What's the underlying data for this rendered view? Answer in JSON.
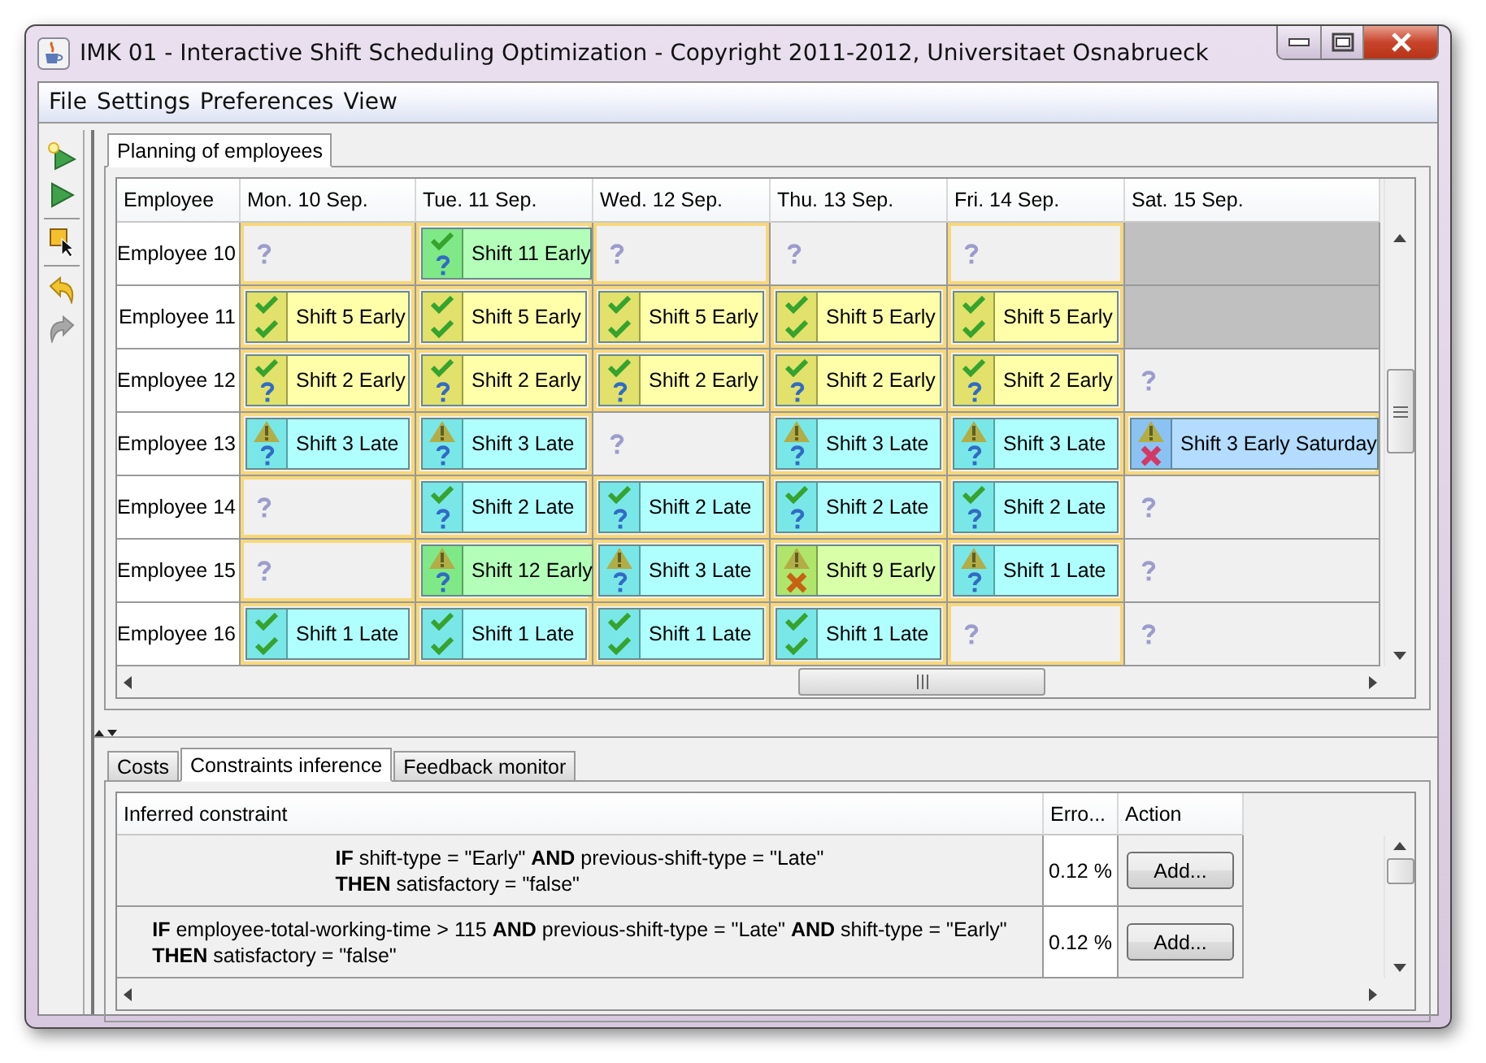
{
  "window": {
    "title": "IMK 01 - Interactive Shift Scheduling Optimization - Copyright 2011-2012, Universitaet Osnabrueck"
  },
  "menu": [
    "File",
    "Settings",
    "Preferences",
    "View"
  ],
  "toolbar": [
    {
      "kind": "new-run",
      "disabled": false
    },
    {
      "kind": "run",
      "disabled": false
    },
    {
      "kind": "select",
      "disabled": false
    },
    {
      "kind": "undo",
      "disabled": false
    },
    {
      "kind": "redo",
      "disabled": true
    }
  ],
  "top_tabs": [
    {
      "label": "Planning of employees",
      "selected": true
    }
  ],
  "schedule": {
    "columns": [
      "Employee",
      "Mon. 10 Sep.",
      "Tue. 11 Sep.",
      "Wed. 12 Sep.",
      "Thu. 13 Sep.",
      "Fri. 14 Sep.",
      "Sat. 15 Sep."
    ],
    "rows": [
      {
        "cells": [
          {
            "kind": "employee",
            "label": "Employee 10"
          },
          {
            "kind": "empty",
            "highlighted": true
          },
          {
            "kind": "shift",
            "label": "Shift 11 Early",
            "color": "#b3ffb9",
            "warning": false,
            "confirmed": false,
            "rejected": false,
            "highlighted": true
          },
          {
            "kind": "empty",
            "highlighted": true
          },
          {
            "kind": "empty",
            "highlighted": false
          },
          {
            "kind": "empty",
            "highlighted": true
          },
          {
            "kind": "unavailable"
          }
        ]
      },
      {
        "cells": [
          {
            "kind": "employee",
            "label": "Employee 11"
          },
          {
            "kind": "shift",
            "label": "Shift 5 Early",
            "color": "#ffffaa",
            "warning": false,
            "confirmed": true,
            "rejected": false,
            "highlighted": true
          },
          {
            "kind": "shift",
            "label": "Shift 5 Early",
            "color": "#ffffaa",
            "warning": false,
            "confirmed": true,
            "rejected": false,
            "highlighted": true
          },
          {
            "kind": "shift",
            "label": "Shift 5 Early",
            "color": "#ffffaa",
            "warning": false,
            "confirmed": true,
            "rejected": false,
            "highlighted": true
          },
          {
            "kind": "shift",
            "label": "Shift 5 Early",
            "color": "#ffffaa",
            "warning": false,
            "confirmed": true,
            "rejected": false,
            "highlighted": true
          },
          {
            "kind": "shift",
            "label": "Shift 5 Early",
            "color": "#ffffaa",
            "warning": false,
            "confirmed": true,
            "rejected": false,
            "highlighted": true
          },
          {
            "kind": "unavailable"
          }
        ]
      },
      {
        "cells": [
          {
            "kind": "employee",
            "label": "Employee 12"
          },
          {
            "kind": "shift",
            "label": "Shift 2 Early",
            "color": "#ffffaa",
            "warning": false,
            "confirmed": false,
            "rejected": false,
            "highlighted": true
          },
          {
            "kind": "shift",
            "label": "Shift 2 Early",
            "color": "#ffffaa",
            "warning": false,
            "confirmed": false,
            "rejected": false,
            "highlighted": true
          },
          {
            "kind": "shift",
            "label": "Shift 2 Early",
            "color": "#ffffaa",
            "warning": false,
            "confirmed": false,
            "rejected": false,
            "highlighted": true
          },
          {
            "kind": "shift",
            "label": "Shift 2 Early",
            "color": "#ffffaa",
            "warning": false,
            "confirmed": false,
            "rejected": false,
            "highlighted": true
          },
          {
            "kind": "shift",
            "label": "Shift 2 Early",
            "color": "#ffffaa",
            "warning": false,
            "confirmed": false,
            "rejected": false,
            "highlighted": true
          },
          {
            "kind": "empty",
            "highlighted": false
          }
        ]
      },
      {
        "cells": [
          {
            "kind": "employee",
            "label": "Employee 13"
          },
          {
            "kind": "shift",
            "label": "Shift 3 Late",
            "color": "#b0ffff",
            "warning": true,
            "confirmed": false,
            "rejected": false,
            "highlighted": true
          },
          {
            "kind": "shift",
            "label": "Shift 3 Late",
            "color": "#b0ffff",
            "warning": true,
            "confirmed": false,
            "rejected": false,
            "highlighted": true
          },
          {
            "kind": "empty",
            "highlighted": false
          },
          {
            "kind": "shift",
            "label": "Shift 3 Late",
            "color": "#b0ffff",
            "warning": true,
            "confirmed": false,
            "rejected": false,
            "highlighted": true
          },
          {
            "kind": "shift",
            "label": "Shift 3 Late",
            "color": "#b0ffff",
            "warning": true,
            "confirmed": false,
            "rejected": false,
            "highlighted": true
          },
          {
            "kind": "shift",
            "label": "Shift 3 Early Saturday",
            "color": "#b3dcff",
            "warning": true,
            "rejected": true,
            "highlighted": true
          }
        ]
      },
      {
        "cells": [
          {
            "kind": "employee",
            "label": "Employee 14"
          },
          {
            "kind": "empty",
            "highlighted": true
          },
          {
            "kind": "shift",
            "label": "Shift 2 Late",
            "color": "#b0ffff",
            "warning": false,
            "confirmed": false,
            "rejected": false,
            "highlighted": true
          },
          {
            "kind": "shift",
            "label": "Shift 2 Late",
            "color": "#b0ffff",
            "warning": false,
            "confirmed": false,
            "rejected": false,
            "highlighted": true
          },
          {
            "kind": "shift",
            "label": "Shift 2 Late",
            "color": "#b0ffff",
            "warning": false,
            "confirmed": false,
            "rejected": false,
            "highlighted": true
          },
          {
            "kind": "shift",
            "label": "Shift 2 Late",
            "color": "#b0ffff",
            "warning": false,
            "confirmed": false,
            "rejected": false,
            "highlighted": true
          },
          {
            "kind": "empty",
            "highlighted": false
          }
        ]
      },
      {
        "cells": [
          {
            "kind": "employee",
            "label": "Employee 15"
          },
          {
            "kind": "empty",
            "highlighted": true
          },
          {
            "kind": "shift",
            "label": "Shift 12 Early",
            "color": "#b3ffb9",
            "warning": true,
            "confirmed": false,
            "rejected": false,
            "highlighted": true
          },
          {
            "kind": "shift",
            "label": "Shift 3 Late",
            "color": "#b0ffff",
            "warning": true,
            "confirmed": false,
            "rejected": false,
            "highlighted": true
          },
          {
            "kind": "shift",
            "label": "Shift 9 Early",
            "color": "#d9ffa8",
            "warning": true,
            "rejected": true,
            "highlighted": true
          },
          {
            "kind": "shift",
            "label": "Shift 1 Late",
            "color": "#b0ffff",
            "warning": true,
            "confirmed": false,
            "rejected": false,
            "highlighted": true
          },
          {
            "kind": "empty",
            "highlighted": false
          }
        ]
      },
      {
        "cells": [
          {
            "kind": "employee",
            "label": "Employee 16"
          },
          {
            "kind": "shift",
            "label": "Shift 1 Late",
            "color": "#b0ffff",
            "warning": false,
            "confirmed": true,
            "rejected": false,
            "highlighted": true
          },
          {
            "kind": "shift",
            "label": "Shift 1 Late",
            "color": "#b0ffff",
            "warning": false,
            "confirmed": true,
            "rejected": false,
            "highlighted": true
          },
          {
            "kind": "shift",
            "label": "Shift 1 Late",
            "color": "#b0ffff",
            "warning": false,
            "confirmed": true,
            "rejected": false,
            "highlighted": true
          },
          {
            "kind": "shift",
            "label": "Shift 1 Late",
            "color": "#b0ffff",
            "warning": false,
            "confirmed": true,
            "rejected": false,
            "highlighted": true
          },
          {
            "kind": "empty",
            "highlighted": true
          },
          {
            "kind": "empty",
            "highlighted": false
          }
        ]
      }
    ]
  },
  "bottom_tabs": [
    {
      "label": "Costs",
      "selected": false
    },
    {
      "label": "Constraints inference",
      "selected": true
    },
    {
      "label": "Feedback monitor",
      "selected": false
    }
  ],
  "constraints": {
    "columns": [
      "Inferred constraint",
      "Erro...",
      "Action"
    ],
    "rows": [
      {
        "constraint": "**IF** shift-type = \"Early\" **AND** previous-shift-type = \"Late\"\n**THEN** satisfactory = \"false\"",
        "error": "0.12 %",
        "action": "Add..."
      },
      {
        "constraint": "**IF** employee-total-working-time > 115 **AND** previous-shift-type = \"Late\" **AND** shift-type = \"Early\"\n**THEN** satisfactory = \"false\"",
        "error": "0.12 %",
        "action": "Add..."
      }
    ]
  }
}
